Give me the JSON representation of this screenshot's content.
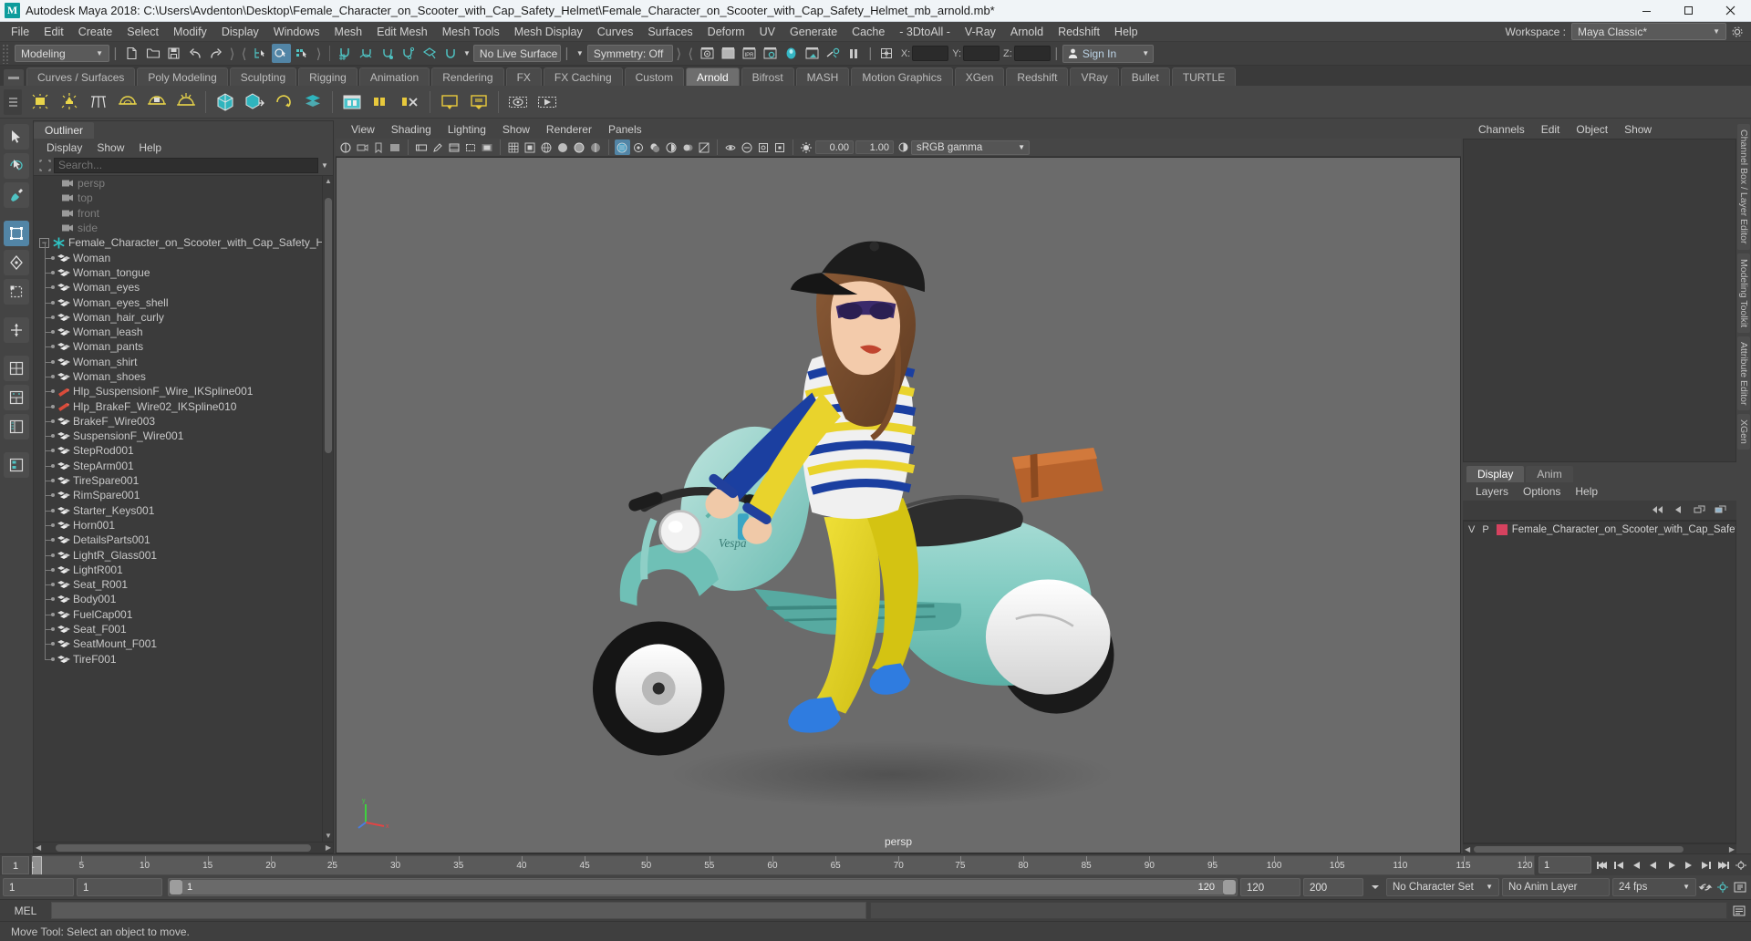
{
  "window": {
    "title": "Autodesk Maya 2018: C:\\Users\\Avdenton\\Desktop\\Female_Character_on_Scooter_with_Cap_Safety_Helmet\\Female_Character_on_Scooter_with_Cap_Safety_Helmet_mb_arnold.mb*",
    "minimize_label": "—",
    "maximize_label": "☐",
    "close_label": "✕",
    "app_icon": "M"
  },
  "menubar": {
    "items": [
      "File",
      "Edit",
      "Create",
      "Select",
      "Modify",
      "Display",
      "Windows",
      "Mesh",
      "Edit Mesh",
      "Mesh Tools",
      "Mesh Display",
      "Curves",
      "Surfaces",
      "Deform",
      "UV",
      "Generate",
      "Cache",
      "- 3DtoAll -",
      "V-Ray",
      "Arnold",
      "Redshift",
      "Help"
    ]
  },
  "statusline": {
    "menuset": "Modeling",
    "live_surface": "No Live Surface",
    "symmetry": "Symmetry: Off",
    "x_label": "X:",
    "y_label": "Y:",
    "z_label": "Z:",
    "x_value": "",
    "y_value": "",
    "z_value": "",
    "signin": "Sign In",
    "workspace_label": "Workspace :",
    "workspace_value": "Maya Classic*"
  },
  "shelf": {
    "tabs": [
      "Curves / Surfaces",
      "Poly Modeling",
      "Sculpting",
      "Rigging",
      "Animation",
      "Rendering",
      "FX",
      "FX Caching",
      "Custom",
      "Arnold",
      "Bifrost",
      "MASH",
      "Motion Graphics",
      "XGen",
      "Redshift",
      "VRay",
      "Bullet",
      "TURTLE"
    ],
    "selected_tab": "Arnold"
  },
  "outliner": {
    "tab_label": "Outliner",
    "menus": [
      "Display",
      "Show",
      "Help"
    ],
    "search_placeholder": "Search...",
    "items": [
      {
        "label": "persp",
        "icon": "camera-icon",
        "kind": "camera",
        "depth": 1,
        "dim": true
      },
      {
        "label": "top",
        "icon": "camera-icon",
        "kind": "camera",
        "depth": 1,
        "dim": true
      },
      {
        "label": "front",
        "icon": "camera-icon",
        "kind": "camera",
        "depth": 1,
        "dim": true
      },
      {
        "label": "side",
        "icon": "camera-icon",
        "kind": "camera",
        "depth": 1,
        "dim": true
      },
      {
        "label": "Female_Character_on_Scooter_with_Cap_Safety_Helmet_",
        "icon": "group-star-icon",
        "kind": "group",
        "depth": 0,
        "expanded": true,
        "dim": false
      },
      {
        "label": "Woman",
        "icon": "mesh-icon",
        "kind": "mesh",
        "depth": 1,
        "dim": false
      },
      {
        "label": "Woman_tongue",
        "icon": "mesh-icon",
        "kind": "mesh",
        "depth": 1,
        "dim": false
      },
      {
        "label": "Woman_eyes",
        "icon": "mesh-icon",
        "kind": "mesh",
        "depth": 1,
        "dim": false
      },
      {
        "label": "Woman_eyes_shell",
        "icon": "mesh-icon",
        "kind": "mesh",
        "depth": 1,
        "dim": false
      },
      {
        "label": "Woman_hair_curly",
        "icon": "mesh-icon",
        "kind": "mesh",
        "depth": 1,
        "dim": false
      },
      {
        "label": "Woman_leash",
        "icon": "mesh-icon",
        "kind": "mesh",
        "depth": 1,
        "dim": false
      },
      {
        "label": "Woman_pants",
        "icon": "mesh-icon",
        "kind": "mesh",
        "depth": 1,
        "dim": false
      },
      {
        "label": "Woman_shirt",
        "icon": "mesh-icon",
        "kind": "mesh",
        "depth": 1,
        "dim": false
      },
      {
        "label": "Woman_shoes",
        "icon": "mesh-icon",
        "kind": "mesh",
        "depth": 1,
        "dim": false
      },
      {
        "label": "Hlp_SuspensionF_Wire_IKSpline001",
        "icon": "ikhandle-icon",
        "kind": "ik",
        "depth": 1,
        "dim": false
      },
      {
        "label": "Hlp_BrakeF_Wire02_IKSpline010",
        "icon": "ikhandle-icon",
        "kind": "ik",
        "depth": 1,
        "dim": false
      },
      {
        "label": "BrakeF_Wire003",
        "icon": "mesh-icon",
        "kind": "mesh",
        "depth": 1,
        "dim": false
      },
      {
        "label": "SuspensionF_Wire001",
        "icon": "mesh-icon",
        "kind": "mesh",
        "depth": 1,
        "dim": false
      },
      {
        "label": "StepRod001",
        "icon": "mesh-icon",
        "kind": "mesh",
        "depth": 1,
        "dim": false
      },
      {
        "label": "StepArm001",
        "icon": "mesh-icon",
        "kind": "mesh",
        "depth": 1,
        "dim": false
      },
      {
        "label": "TireSpare001",
        "icon": "mesh-icon",
        "kind": "mesh",
        "depth": 1,
        "dim": false
      },
      {
        "label": "RimSpare001",
        "icon": "mesh-icon",
        "kind": "mesh",
        "depth": 1,
        "dim": false
      },
      {
        "label": "Starter_Keys001",
        "icon": "mesh-icon",
        "kind": "mesh",
        "depth": 1,
        "dim": false
      },
      {
        "label": "Horn001",
        "icon": "mesh-icon",
        "kind": "mesh",
        "depth": 1,
        "dim": false
      },
      {
        "label": "DetailsParts001",
        "icon": "mesh-icon",
        "kind": "mesh",
        "depth": 1,
        "dim": false
      },
      {
        "label": "LightR_Glass001",
        "icon": "mesh-icon",
        "kind": "mesh",
        "depth": 1,
        "dim": false
      },
      {
        "label": "LightR001",
        "icon": "mesh-icon",
        "kind": "mesh",
        "depth": 1,
        "dim": false
      },
      {
        "label": "Seat_R001",
        "icon": "mesh-icon",
        "kind": "mesh",
        "depth": 1,
        "dim": false
      },
      {
        "label": "Body001",
        "icon": "mesh-icon",
        "kind": "mesh",
        "depth": 1,
        "dim": false
      },
      {
        "label": "FuelCap001",
        "icon": "mesh-icon",
        "kind": "mesh",
        "depth": 1,
        "dim": false
      },
      {
        "label": "Seat_F001",
        "icon": "mesh-icon",
        "kind": "mesh",
        "depth": 1,
        "dim": false
      },
      {
        "label": "SeatMount_F001",
        "icon": "mesh-icon",
        "kind": "mesh",
        "depth": 1,
        "dim": false
      },
      {
        "label": "TireF001",
        "icon": "mesh-icon",
        "kind": "mesh",
        "depth": 1,
        "dim": false
      }
    ]
  },
  "viewport": {
    "menus": [
      "View",
      "Shading",
      "Lighting",
      "Show",
      "Renderer",
      "Panels"
    ],
    "exposure_value": "0.00",
    "gamma_value": "1.00",
    "color_profile": "sRGB gamma",
    "camera_label": "persp"
  },
  "channelbox": {
    "tabs": [
      "Channels",
      "Edit",
      "Object",
      "Show"
    ]
  },
  "layers": {
    "tabs": [
      "Display",
      "Anim"
    ],
    "selected_tab": "Display",
    "menus": [
      "Layers",
      "Options",
      "Help"
    ],
    "rows": [
      {
        "v": "V",
        "p": "P",
        "color": "#d6425f",
        "name": "Female_Character_on_Scooter_with_Cap_Safety_Helme"
      }
    ]
  },
  "right_tabs": [
    "Channel Box / Layer Editor",
    "Modeling Toolkit",
    "Attribute Editor",
    "XGen"
  ],
  "timeslider": {
    "current_frame": "1",
    "ticks": [
      {
        "frame": "1",
        "pos": 0
      },
      {
        "frame": "5",
        "pos": 3.3
      },
      {
        "frame": "10",
        "pos": 7.5
      },
      {
        "frame": "15",
        "pos": 11.7
      },
      {
        "frame": "20",
        "pos": 15.9
      },
      {
        "frame": "25",
        "pos": 20.0
      },
      {
        "frame": "30",
        "pos": 24.2
      },
      {
        "frame": "35",
        "pos": 28.4
      },
      {
        "frame": "40",
        "pos": 32.6
      },
      {
        "frame": "45",
        "pos": 36.8
      },
      {
        "frame": "50",
        "pos": 40.9
      },
      {
        "frame": "55",
        "pos": 45.1
      },
      {
        "frame": "60",
        "pos": 49.3
      },
      {
        "frame": "65",
        "pos": 53.5
      },
      {
        "frame": "70",
        "pos": 57.7
      },
      {
        "frame": "75",
        "pos": 61.8
      },
      {
        "frame": "80",
        "pos": 66.0
      },
      {
        "frame": "85",
        "pos": 70.2
      },
      {
        "frame": "90",
        "pos": 74.4
      },
      {
        "frame": "95",
        "pos": 78.6
      },
      {
        "frame": "100",
        "pos": 82.7
      },
      {
        "frame": "105",
        "pos": 86.9
      },
      {
        "frame": "110",
        "pos": 91.1
      },
      {
        "frame": "115",
        "pos": 95.3
      },
      {
        "frame": "120",
        "pos": 99.4
      }
    ],
    "end_field": "1"
  },
  "rangeslider": {
    "anim_start": "1",
    "range_start": "1",
    "range_bar_start_label": "1",
    "range_bar_end_label": "120",
    "range_end": "120",
    "anim_end": "200",
    "character_set": "No Character Set",
    "anim_layer": "No Anim Layer",
    "fps": "24 fps"
  },
  "mel": {
    "label": "MEL",
    "command": ""
  },
  "helpline": {
    "text": "Move Tool: Select an object to move."
  }
}
